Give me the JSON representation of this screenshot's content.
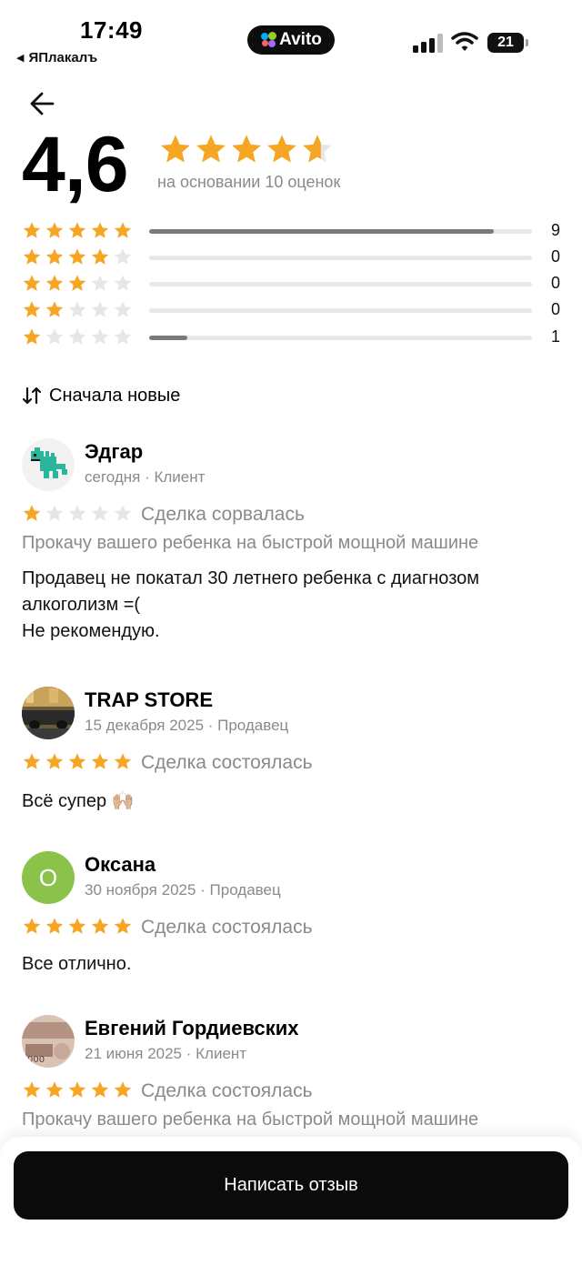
{
  "status_bar": {
    "time": "17:49",
    "back_app": "ЯПлакалъ",
    "app_pill": "Avito",
    "battery": "21"
  },
  "header": {
    "rating": "4,6",
    "rating_value": 4.6,
    "based_on": "на основании 10 оценок"
  },
  "distribution": [
    {
      "stars": 5,
      "count": "9",
      "fraction": 0.9
    },
    {
      "stars": 4,
      "count": "0",
      "fraction": 0
    },
    {
      "stars": 3,
      "count": "0",
      "fraction": 0
    },
    {
      "stars": 2,
      "count": "0",
      "fraction": 0
    },
    {
      "stars": 1,
      "count": "1",
      "fraction": 0.1
    }
  ],
  "sort": {
    "label": "Сначала новые"
  },
  "reviews": [
    {
      "name": "Эдгар",
      "meta": "сегодня · Клиент",
      "stars": 1,
      "status": "Сделка сорвалась",
      "subject": "Прокачу вашего ребенка на быстрой мощной машине",
      "text": "Продавец не покатал 30 летнего ребенка с диагнозом алкоголизм =(\nНе рекомендую.",
      "avatar": "dragon-avatar"
    },
    {
      "name": "TRAP STORE",
      "meta": "15 декабря 2025 · Продавец",
      "stars": 5,
      "status": "Сделка состоялась",
      "subject": "",
      "text": "Всё супер 🙌🏼",
      "avatar": "photo-avatar"
    },
    {
      "name": "Оксана",
      "meta": "30 ноября 2025 · Продавец",
      "stars": 5,
      "status": "Сделка состоялась",
      "subject": "",
      "text": "Все отлично.",
      "avatar": "letter-avatar",
      "avatar_letter": "О",
      "avatar_color": "#8bc34a"
    },
    {
      "name": "Евгений Гордиевских",
      "meta": "21 июня 2025 · Клиент",
      "stars": 5,
      "status": "Сделка состоялась",
      "subject": "Прокачу вашего ребенка на быстрой мощной машине",
      "text": "",
      "avatar": "banknote-avatar"
    }
  ],
  "footer": {
    "write_review": "Написать отзыв"
  },
  "colors": {
    "star": "#f6a623",
    "star_empty": "#e6e6e6",
    "bar_fill": "#7a7a7a",
    "bar_track": "#e8e8e8",
    "button": "#0b0b0b"
  },
  "icons": [
    "back-arrow-icon",
    "sort-icon",
    "star-icon",
    "signal-icon",
    "wifi-icon",
    "battery-icon"
  ]
}
